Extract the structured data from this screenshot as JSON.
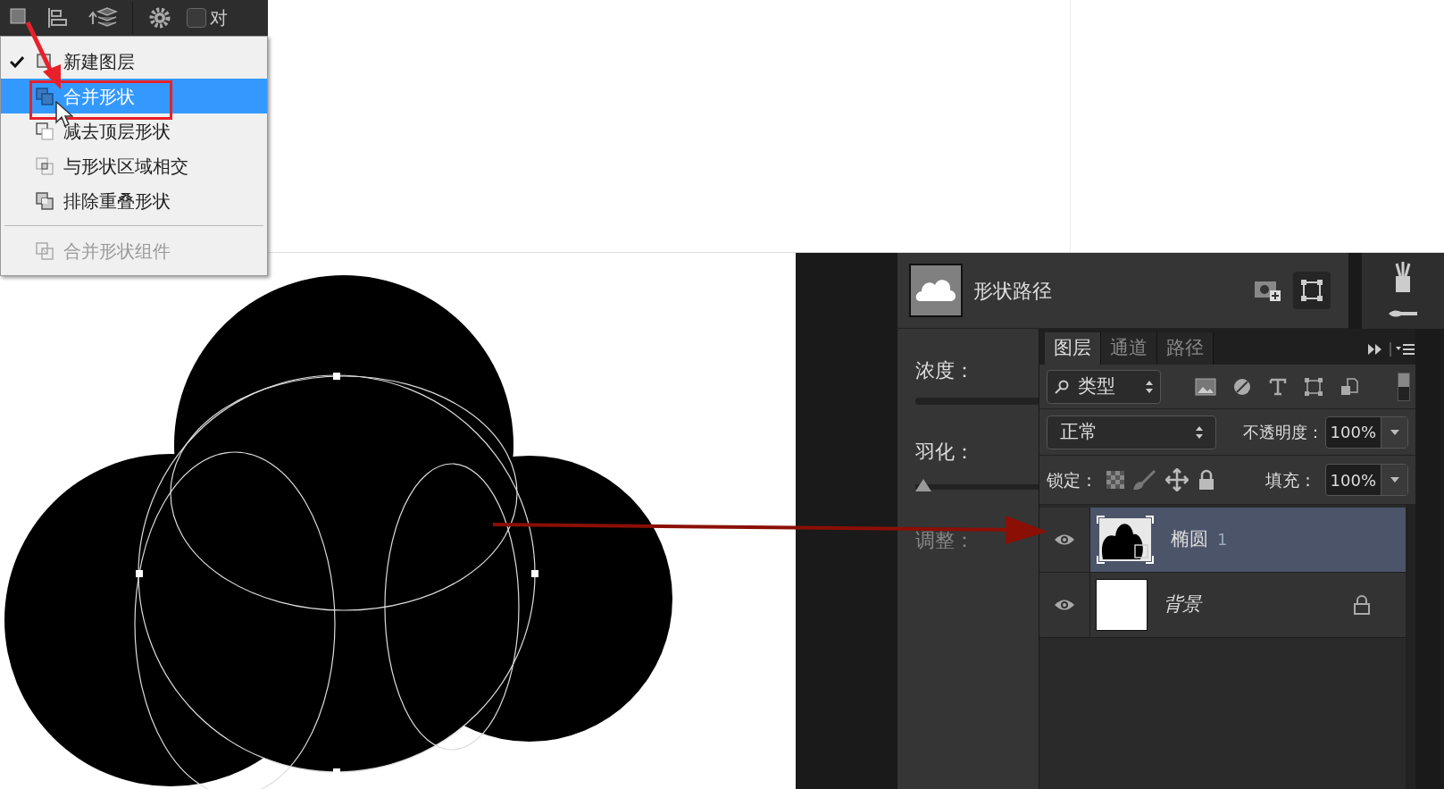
{
  "toolbar": {
    "checkbox": {
      "label": "对",
      "checked": false
    }
  },
  "menu": {
    "items": [
      {
        "label": "新建图层",
        "kind": "mode",
        "checked": true,
        "selected": false,
        "disabled": false
      },
      {
        "label": "合并形状",
        "kind": "mode",
        "checked": false,
        "selected": true,
        "disabled": false
      },
      {
        "label": "减去顶层形状",
        "kind": "mode",
        "checked": false,
        "selected": false,
        "disabled": false
      },
      {
        "label": "与形状区域相交",
        "kind": "mode",
        "checked": false,
        "selected": false,
        "disabled": false
      },
      {
        "label": "排除重叠形状",
        "kind": "mode",
        "checked": false,
        "selected": false,
        "disabled": false
      },
      {
        "label": "合并形状组件",
        "kind": "component",
        "checked": false,
        "selected": false,
        "disabled": true
      }
    ]
  },
  "properties": {
    "title": "形状路径",
    "fields": [
      {
        "label": "浓度：",
        "kind": "track",
        "disabled": false
      },
      {
        "label": "羽化：",
        "kind": "slider",
        "level": 0,
        "disabled": false
      },
      {
        "label": "调整：",
        "kind": "label",
        "disabled": true
      }
    ]
  },
  "layers": {
    "tabs": [
      {
        "label": "图层",
        "selected": true
      },
      {
        "label": "通道",
        "selected": false
      },
      {
        "label": "路径",
        "selected": false
      }
    ],
    "filter": {
      "value": "类型"
    },
    "blend_mode": {
      "value": "正常"
    },
    "opacity": {
      "label": "不透明度：",
      "value": "100%"
    },
    "lock": {
      "label": "锁定："
    },
    "fill": {
      "label": "填充：",
      "value": "100%"
    },
    "items": [
      {
        "name": "椭圆",
        "suffix": "1",
        "kind": "shape",
        "selected": true,
        "locked": false
      },
      {
        "name": "背景",
        "kind": "background",
        "selected": false,
        "locked": true
      }
    ]
  }
}
